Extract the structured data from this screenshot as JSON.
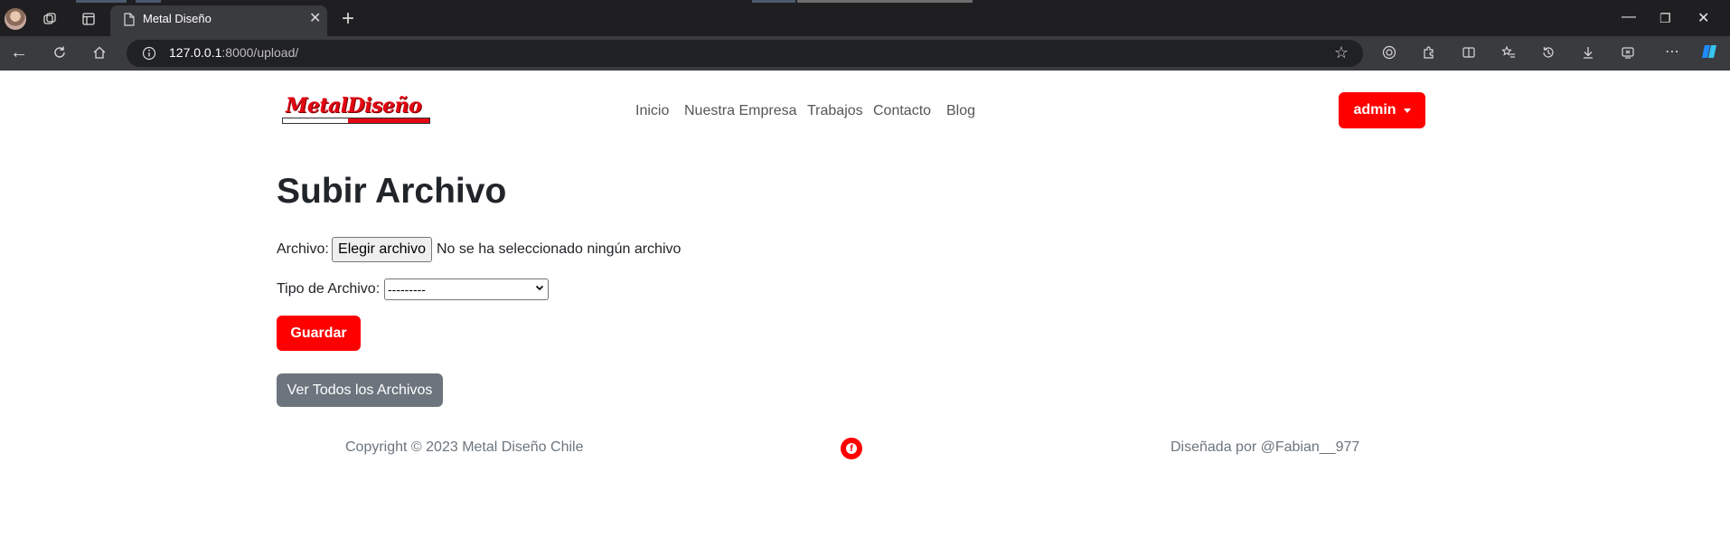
{
  "browser": {
    "tab_title": "Metal Diseño",
    "url_host": "127.0.0.1",
    "url_rest": ":8000/upload/"
  },
  "header": {
    "logo_text": "MetalDiseño",
    "nav": [
      "Inicio",
      "Nuestra Empresa",
      "Trabajos",
      "Contacto",
      "Blog"
    ],
    "user_label": "admin"
  },
  "main": {
    "title": "Subir Archivo",
    "file_label": "Archivo:",
    "file_button": "Elegir archivo",
    "file_status": "No se ha seleccionado ningún archivo",
    "type_label": "Tipo de Archivo:",
    "type_value": "---------",
    "save_label": "Guardar",
    "view_all_label": "Ver Todos los Archivos"
  },
  "footer": {
    "copyright": "Copyright © 2023 Metal Diseño Chile",
    "credit": "Diseñada por @Fabian__977"
  },
  "colors": {
    "brand_red": "#ff0000",
    "secondary": "#6c757d"
  }
}
